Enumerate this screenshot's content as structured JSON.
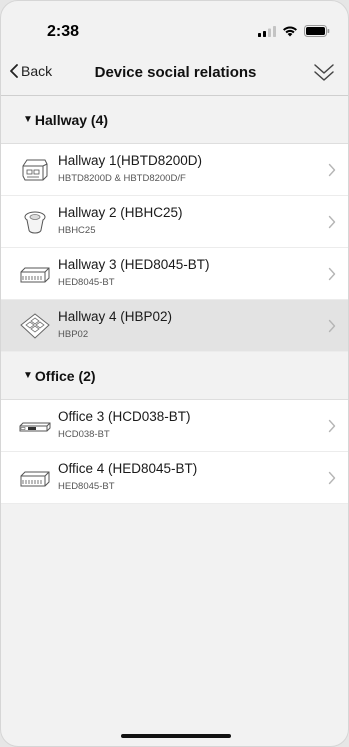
{
  "status_bar": {
    "time": "2:38",
    "icons": [
      "signal-icon",
      "wifi-icon",
      "battery-icon"
    ]
  },
  "nav": {
    "back_label": "Back",
    "title": "Device social relations",
    "back_icon": "chevron-left-icon",
    "collapse_icon": "double-chevron-down-icon"
  },
  "groups": [
    {
      "label": "Hallway (4)",
      "expanded": true,
      "devices": [
        {
          "name": "Hallway 1(HBTD8200D)",
          "model": "HBTD8200D & HBTD8200D/F",
          "icon": "din-rail-module-icon",
          "selected": false
        },
        {
          "name": "Hallway 2 (HBHC25)",
          "model": "HBHC25",
          "icon": "ceiling-sensor-icon",
          "selected": false
        },
        {
          "name": "Hallway 3 (HED8045-BT)",
          "model": "HED8045-BT",
          "icon": "led-driver-icon",
          "selected": false
        },
        {
          "name": "Hallway 4 (HBP02)",
          "model": "HBP02",
          "icon": "push-button-panel-icon",
          "selected": true
        }
      ]
    },
    {
      "label": "Office (2)",
      "expanded": true,
      "devices": [
        {
          "name": "Office 3 (HCD038-BT)",
          "model": "HCD038-BT",
          "icon": "linear-driver-icon",
          "selected": false
        },
        {
          "name": "Office 4 (HED8045-BT)",
          "model": "HED8045-BT",
          "icon": "led-driver-icon",
          "selected": false
        }
      ]
    }
  ],
  "colors": {
    "background": "#f2f2f2",
    "row_background": "#ffffff",
    "selected_row": "#e3e3e3",
    "text": "#1a1a1a",
    "secondary_text": "#555555",
    "chevron": "#b5b5b5"
  }
}
